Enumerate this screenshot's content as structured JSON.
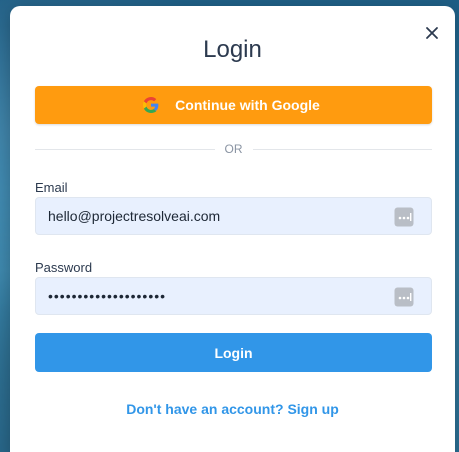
{
  "modal": {
    "title": "Login",
    "close_icon": "close-icon"
  },
  "google": {
    "label": "Continue with Google",
    "icon": "google-icon"
  },
  "divider": {
    "text": "OR"
  },
  "email": {
    "label": "Email",
    "value": "hello@projectresolveai.com",
    "autofill_icon": "password-manager-icon"
  },
  "password": {
    "label": "Password",
    "masked_value": "••••••••••••••••••••",
    "autofill_icon": "password-manager-icon"
  },
  "actions": {
    "login_label": "Login",
    "signup_label": "Don't have an account? Sign up"
  },
  "colors": {
    "google_button": "#ff9b0f",
    "primary": "#3196e8",
    "input_bg": "#e8f0fe",
    "title": "#2c3a4f"
  }
}
